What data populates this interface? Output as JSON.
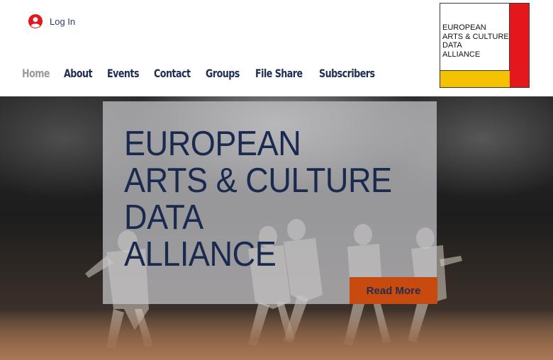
{
  "header": {
    "login": {
      "label": "Log In",
      "icon": "user-avatar-icon",
      "icon_color": "#e3171c"
    },
    "nav": [
      {
        "label": "Home",
        "active": true
      },
      {
        "label": "About",
        "active": false
      },
      {
        "label": "Events",
        "active": false
      },
      {
        "label": "Contact",
        "active": false
      },
      {
        "label": "Groups",
        "active": false
      },
      {
        "label": "File Share",
        "active": false
      },
      {
        "label": "Subscribers",
        "active": false
      }
    ],
    "logo": {
      "lines": [
        "EUROPEAN",
        "ARTS & CULTURE",
        "DATA",
        "ALLIANCE"
      ],
      "accent_red": "#e3171c",
      "accent_yellow": "#f4c200"
    }
  },
  "hero": {
    "title_lines": [
      "EUROPEAN",
      "ARTS & CULTURE",
      "DATA",
      "ALLIANCE"
    ],
    "button_label": "Read More",
    "button_color": "#c84a0f",
    "text_color": "#1a2a4e"
  }
}
